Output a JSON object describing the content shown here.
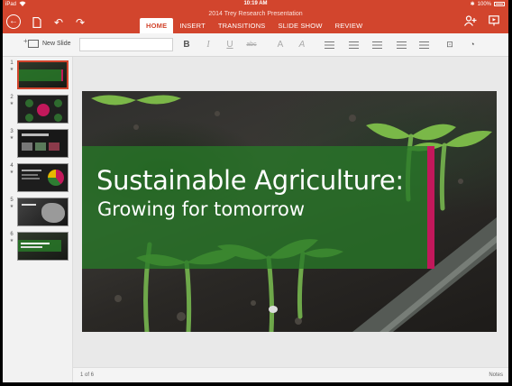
{
  "status_bar": {
    "carrier": "iPad",
    "time": "10:19 AM",
    "battery": "100%"
  },
  "document": {
    "title": "2014 Trey Research Presentation"
  },
  "tabs": [
    {
      "label": "HOME",
      "active": true
    },
    {
      "label": "INSERT",
      "active": false
    },
    {
      "label": "TRANSITIONS",
      "active": false
    },
    {
      "label": "SLIDE SHOW",
      "active": false
    },
    {
      "label": "REVIEW",
      "active": false
    }
  ],
  "ribbon": {
    "new_slide_label": "New Slide",
    "font_name_value": "",
    "bold_label": "B",
    "italic_label": "I",
    "underline_label": "U",
    "strikethrough_label": "abc",
    "font_color_label": "A",
    "clear_format_label": "A"
  },
  "thumbnails": [
    {
      "number": "1",
      "selected": true
    },
    {
      "number": "2",
      "selected": false
    },
    {
      "number": "3",
      "selected": false
    },
    {
      "number": "4",
      "selected": false
    },
    {
      "number": "5",
      "selected": false
    },
    {
      "number": "6",
      "selected": false
    }
  ],
  "slide": {
    "title": "Sustainable Agriculture:",
    "subtitle": "Growing for tomorrow",
    "colors": {
      "band": "#2e7d32",
      "accent": "#c2185b"
    }
  },
  "footer": {
    "page_indicator": "1 of 6",
    "notes_label": "Notes"
  },
  "colors": {
    "brand": "#d2452d"
  }
}
